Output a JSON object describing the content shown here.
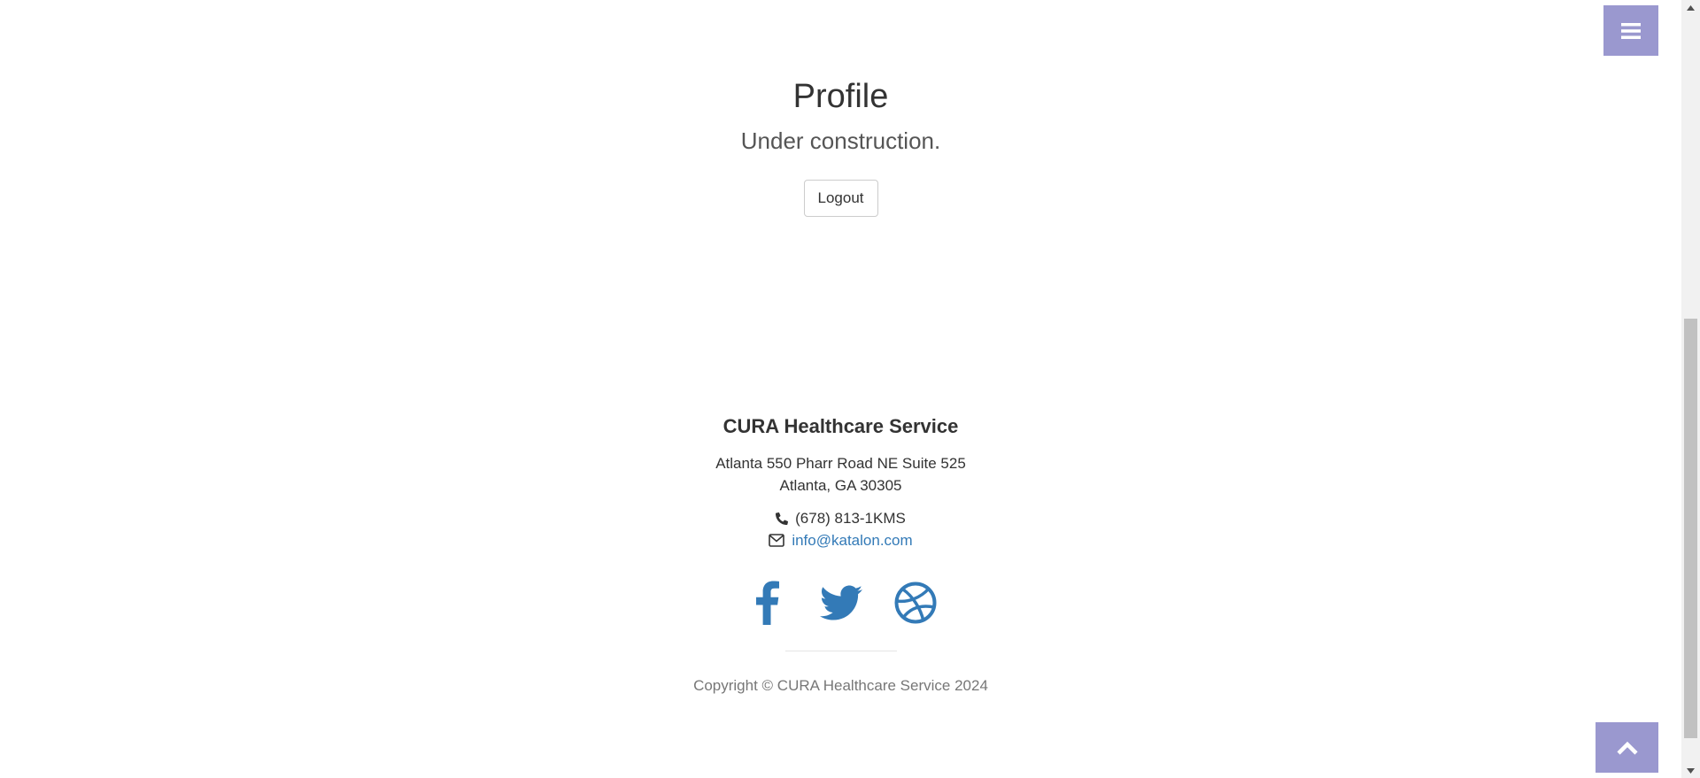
{
  "menu": {
    "icon": "hamburger-menu-icon"
  },
  "profile": {
    "title": "Profile",
    "subtitle": "Under construction.",
    "logout_label": "Logout"
  },
  "footer": {
    "title": "CURA Healthcare Service",
    "address_line1": "Atlanta 550 Pharr Road NE Suite 525",
    "address_line2": "Atlanta, GA 30305",
    "phone": "(678) 813-1KMS",
    "email": "info@katalon.com",
    "social": [
      "facebook-icon",
      "twitter-icon",
      "dribbble-icon"
    ],
    "copyright": "Copyright © CURA Healthcare Service 2024"
  },
  "colors": {
    "accent": "#9a98cf",
    "link": "#337ab7",
    "text": "#333333",
    "muted": "#777777"
  }
}
